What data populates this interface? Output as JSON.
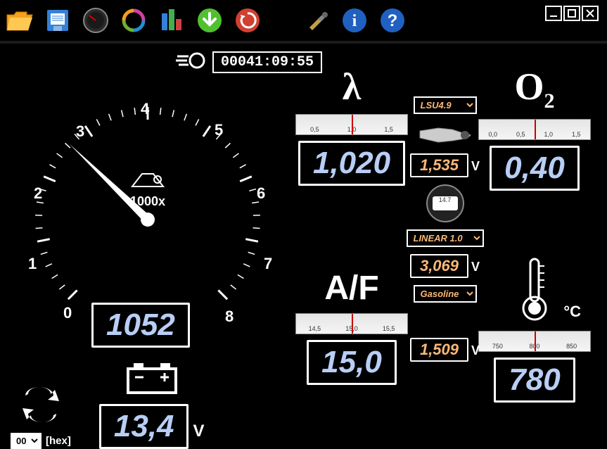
{
  "timer": "00041:09:55",
  "gauge": {
    "multiplier_label": "1000x",
    "rpm": "1052",
    "numbers": [
      "0",
      "1",
      "2",
      "3",
      "4",
      "5",
      "6",
      "7",
      "8"
    ]
  },
  "lambda": {
    "symbol": "λ",
    "value": "1,020",
    "ruler_ticks": [
      "0,5",
      "1,0",
      "1,5"
    ]
  },
  "o2": {
    "symbol": "O",
    "sub": "2",
    "value": "0,40",
    "ruler_ticks": [
      "0,0",
      "0,5",
      "1,0",
      "1,5"
    ]
  },
  "af": {
    "symbol": "A/F",
    "value": "15,0",
    "ruler_ticks": [
      "14,5",
      "15,0",
      "15,5"
    ]
  },
  "temp": {
    "value": "780",
    "unit": "°C",
    "ruler_ticks": [
      "750",
      "800",
      "850"
    ]
  },
  "mid": {
    "sensor_type": "LSU4.9",
    "sensor_options": [
      "LSU4.9"
    ],
    "v1": "1,535",
    "output_mode": "LINEAR 1.0",
    "output_options": [
      "LINEAR 1.0"
    ],
    "v2": "3,069",
    "fuel": "Gasoline",
    "fuel_options": [
      "Gasoline"
    ],
    "v3": "1,509",
    "unit": "V"
  },
  "battery": {
    "value": "13,4",
    "unit": "V"
  },
  "hex": {
    "value": "00",
    "options": [
      "00"
    ],
    "label": "[hex]"
  }
}
